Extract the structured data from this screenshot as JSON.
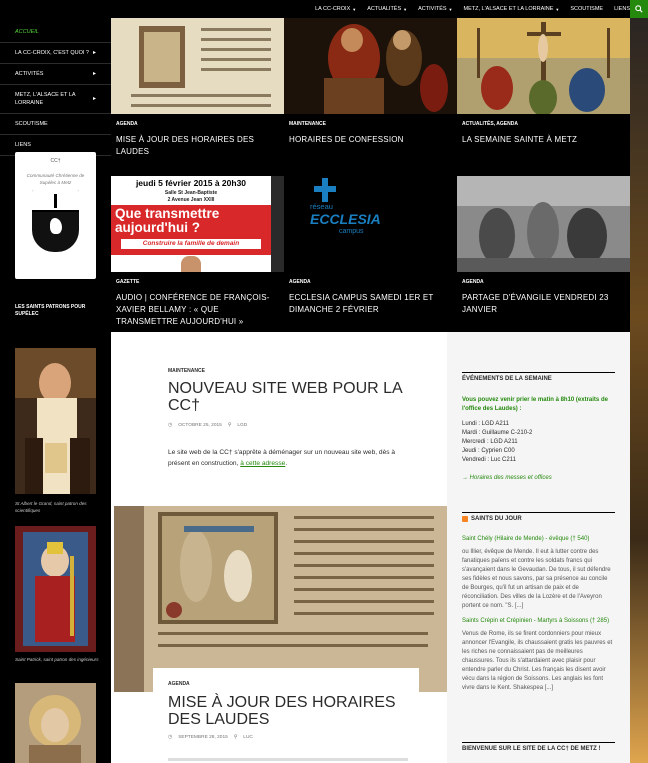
{
  "topnav": {
    "items": [
      {
        "label": "LA CC-CROIX",
        "has_menu": true
      },
      {
        "label": "ACTUALITÉS",
        "has_menu": true
      },
      {
        "label": "ACTIVITÉS",
        "has_menu": true
      },
      {
        "label": "METZ, L'ALSACE ET LA LORRAINE",
        "has_menu": true
      },
      {
        "label": "SCOUTISME",
        "has_menu": false
      },
      {
        "label": "LIENS",
        "has_menu": false
      }
    ],
    "search_icon": "search-icon",
    "accent_color": "#24890d"
  },
  "sidebar": {
    "items": [
      {
        "label": "ACCUEIL",
        "active": true,
        "arrow": ""
      },
      {
        "label": "LA CC-CROIX, C'EST QUOI ?",
        "active": false,
        "arrow": "▸"
      },
      {
        "label": "ACTIVITÉS",
        "active": false,
        "arrow": "▸"
      },
      {
        "label": "METZ, L'ALSACE ET LA LORRAINE",
        "active": false,
        "arrow": "▸"
      },
      {
        "label": "SCOUTISME",
        "active": false,
        "arrow": ""
      },
      {
        "label": "LIENS",
        "active": false,
        "arrow": ""
      }
    ],
    "card": {
      "name": "CC†",
      "tagline": "Communauté Chrétienne de Supélec à Metz"
    },
    "patrons_title": "LES SAINTS PATRONS POUR SUPÉLEC",
    "patrons": [
      {
        "caption": "St Albert le Grand, saint patron des scientifiques"
      },
      {
        "caption": "Saint Patrick, saint patron des ingénieurs"
      }
    ]
  },
  "featured": [
    {
      "category": "AGENDA",
      "title": "MISE À JOUR DES HORAIRES DES LAUDES"
    },
    {
      "category": "MAINTENANCE",
      "title": "HORAIRES DE CONFESSION"
    },
    {
      "category": "ACTUALITÉS, AGENDA",
      "title": "LA SEMAINE SAINTE À METZ"
    },
    {
      "category": "GAZETTE",
      "title": "AUDIO | CONFÉRENCE DE FRANÇOIS-XAVIER BELLAMY : « QUE TRANSMETTRE AUJOURD'HUI »",
      "poster_line1": "jeudi 5 février 2015 à 20h30",
      "poster_line2": "Salle St Jean-Baptiste",
      "poster_line3": "2 Avenue Jean XXIII",
      "poster_title": "Que transmettre aujourd'hui ?",
      "poster_sub": "Construire la famille de demain"
    },
    {
      "category": "AGENDA",
      "title": "ECCLESIA CAMPUS SAMEDI 1ER ET DIMANCHE 2 FÉVRIER",
      "logo_top": "réseau",
      "logo_main": "ECCLESIA",
      "logo_sub": "campus"
    },
    {
      "category": "AGENDA",
      "title": "PARTAGE D'ÉVANGILE VENDREDI 23 JANVIER"
    }
  ],
  "post1": {
    "category": "MAINTENANCE",
    "title": "NOUVEAU SITE WEB POUR LA CC†",
    "date": "OCTOBRE 25, 2015",
    "author": "LGD",
    "text": "Le site web de la CC† s'apprête à déménager sur un nouveau site web, dès à présent en construction,",
    "link_text": "à cette adresse",
    "text_end": "."
  },
  "post2": {
    "category": "AGENDA",
    "title": "MISE À JOUR DES HORAIRES DES LAUDES",
    "date": "SEPTEMBRE 28, 2015",
    "author": "LUC"
  },
  "right": {
    "events_title": "ÉVÉNEMENTS DE LA SEMAINE",
    "events_intro": "Vous pouvez venir prier le matin à 8h10 (extraits de l'office des Laudes) :",
    "schedule": [
      "Lundi : LGD A211",
      "Mardi : Guillaume C-210-2",
      "Mercredi : LGD A211",
      "Jeudi : Cyprien C00",
      "Vendredi : Luc C211"
    ],
    "masses_link": "→ Horaires des messes et offices",
    "saints_title": "SAINTS DU JOUR",
    "saint1_title": "Saint Chély (Hilaire de Mende) - évêque († 540)",
    "saint1_text": "ou Illier, évêque de Mende. Il eut à lutter contre des fanatiques païens et contre les soldats francs qui s'avançaient dans le Gevaudan. De tous, il sut défendre ses fidèles et nous savons, par sa présence au concile de Bourges, qu'il fut un artisan de paix et de réconciliation. Des villes de la Lozère et de l'Aveyron portent ce nom. \"S. [...]",
    "saint2_title": "Saints Crépin et Crépinien - Martyrs à Soissons († 285)",
    "saint2_text": "Venus de Rome, ils se firent cordonniers pour mieux annoncer l'Evangile, ils chaussaient gratis les pauvres et les riches ne connaissaient pas de meilleures chaussures. Tous ils s'attardaient avec plaisir pour entendre parler du Christ. Les français les disent avoir vécu dans la région de Soissons. Les anglais les font vivre dans le Kent. Shakespea [...]",
    "welcome_title": "BIENVENUE SUR LE SITE DE LA CC† DE METZ !"
  }
}
